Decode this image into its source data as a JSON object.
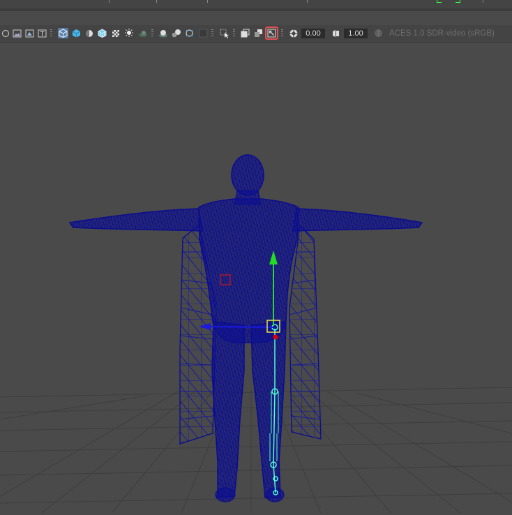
{
  "toolbar": {
    "exposure_value": "0.00",
    "gamma_value": "1.00",
    "color_space_label": "ACES 1.0 SDR-video (sRGB)",
    "buttons": [
      {
        "name": "isolate-select-icon"
      },
      {
        "name": "image-plane-icon"
      },
      {
        "name": "camera-attributes-icon"
      },
      {
        "name": "texture-icon"
      },
      {
        "name": "wireframe-shading-icon",
        "active": true
      },
      {
        "name": "smooth-shade-all-icon"
      },
      {
        "name": "flat-shade-icon"
      },
      {
        "name": "wireframe-on-shaded-icon"
      },
      {
        "name": "xray-icon"
      },
      {
        "name": "use-all-lights-icon"
      },
      {
        "name": "shadows-icon"
      },
      {
        "name": "screen-space-ao-icon"
      },
      {
        "name": "motion-blur-icon"
      },
      {
        "name": "multisample-aa-icon"
      },
      {
        "name": "depth-of-field-icon"
      },
      {
        "name": "isolate-view-icon"
      },
      {
        "name": "xray-joints-icon"
      },
      {
        "name": "xray-active-components-icon"
      },
      {
        "name": "grid-icon"
      },
      {
        "name": "toggle-hud-icon",
        "highlighted": true
      },
      {
        "name": "exposure-icon"
      },
      {
        "name": "gamma-icon"
      },
      {
        "name": "view-transform-icon"
      }
    ]
  },
  "colors": {
    "viewport_bg": "#4a4a4a",
    "wireframe": "#0a0d8c",
    "joint": "#4dffd2",
    "axis_y": "#22dd22",
    "axis_x": "#1a1ae0",
    "pivot": "#e00000",
    "selection_box": "#e8e04a",
    "highlight": "#e44f4f"
  }
}
